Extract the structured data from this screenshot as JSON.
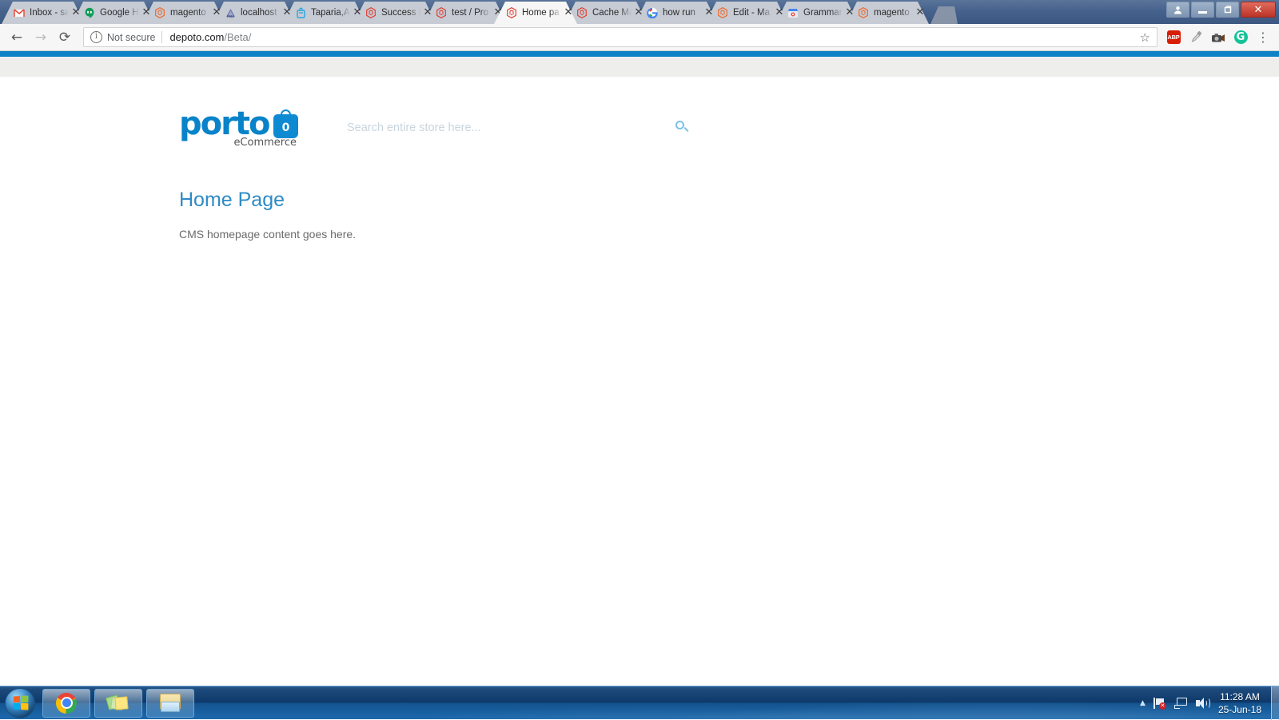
{
  "browser": {
    "tabs": [
      {
        "title": "Inbox - sa",
        "favicon": "gmail-icon",
        "active": false
      },
      {
        "title": "Google H",
        "favicon": "hangouts-icon",
        "active": false
      },
      {
        "title": "magento",
        "favicon": "magento-orange-icon",
        "active": false
      },
      {
        "title": "localhost",
        "favicon": "phpmyadmin-icon",
        "active": false
      },
      {
        "title": "Taparia,A",
        "favicon": "taparia-icon",
        "active": false
      },
      {
        "title": "Success P",
        "favicon": "magento-red-icon",
        "active": false
      },
      {
        "title": "test / Pro",
        "favicon": "magento-red-icon",
        "active": false
      },
      {
        "title": "Home pa",
        "favicon": "magento-red-icon",
        "active": true
      },
      {
        "title": "Cache Ma",
        "favicon": "magento-red-icon",
        "active": false
      },
      {
        "title": "how run",
        "favicon": "google-icon",
        "active": false
      },
      {
        "title": "Edit - Ma",
        "favicon": "magento-orange-icon",
        "active": false
      },
      {
        "title": "Grammar",
        "favicon": "chrome-store-icon",
        "active": false
      },
      {
        "title": "magento",
        "favicon": "magento-orange-icon",
        "active": false
      }
    ],
    "tab_close_label": "✕",
    "window_controls": {
      "user_label": "●",
      "minimize_label": "–",
      "restore_label": "❐",
      "close_label": "✕"
    },
    "toolbar": {
      "back_label": "←",
      "forward_label": "→",
      "reload_label": "⟳",
      "security_icon_label": "ⓘ",
      "security_text": "Not secure",
      "url_domain": "depoto.com",
      "url_path": "/Beta/",
      "star_label": "☆",
      "extensions": [
        {
          "name": "adblock-plus",
          "label": "ABP"
        },
        {
          "name": "color-picker",
          "label": "✒"
        },
        {
          "name": "screenshot-tool",
          "label": "📷"
        },
        {
          "name": "grammarly",
          "label": "G"
        }
      ],
      "menu_label": "⋮"
    }
  },
  "page": {
    "logo": {
      "word": "porto",
      "tagline": "eCommerce",
      "cart_count": "0"
    },
    "search": {
      "placeholder": "Search entire store here...",
      "value": "",
      "button_label": "search-icon"
    },
    "title": "Home Page",
    "body": "CMS homepage content goes here."
  },
  "taskbar": {
    "start_label": "Start",
    "buttons": [
      {
        "name": "chrome",
        "icon": "chrome-icon"
      },
      {
        "name": "sticky-notes",
        "icon": "sticky-notes-icon"
      },
      {
        "name": "windows-explorer",
        "icon": "folder-icon"
      }
    ],
    "tray": {
      "overflow_label": "▲",
      "icons": [
        "action-center-flag-icon",
        "network-icon",
        "volume-icon"
      ],
      "time": "11:28 AM",
      "date": "25-Jun-18"
    }
  },
  "colors": {
    "brand_blue": "#0883c9",
    "load_bar": "#0d82c6",
    "title_blue": "#2e8bc6",
    "gray_band": "#eeeeec"
  }
}
